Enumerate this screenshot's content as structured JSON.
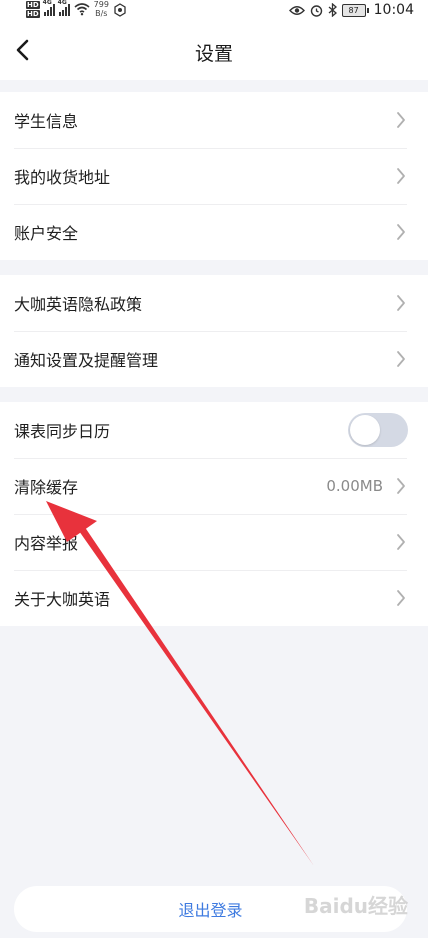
{
  "status_bar": {
    "sim1": "HD",
    "sim2": "HD",
    "net1": "4G",
    "net2": "4G",
    "speed_value": "799",
    "speed_unit": "B/s",
    "battery": "87",
    "time": "10:04"
  },
  "nav": {
    "title": "设置"
  },
  "groups": [
    {
      "items": [
        {
          "label": "学生信息"
        },
        {
          "label": "我的收货地址"
        },
        {
          "label": "账户安全"
        }
      ]
    },
    {
      "items": [
        {
          "label": "大咖英语隐私政策"
        },
        {
          "label": "通知设置及提醒管理"
        }
      ]
    },
    {
      "items": [
        {
          "label": "课表同步日历"
        },
        {
          "label": "清除缓存",
          "value": "0.00MB"
        },
        {
          "label": "内容举报"
        },
        {
          "label": "关于大咖英语"
        }
      ]
    }
  ],
  "logout": {
    "label": "退出登录"
  },
  "colors": {
    "accent": "#3F7BE0",
    "annotation_arrow": "#E8323C",
    "background": "#F3F4F8"
  },
  "watermark": "Baidu经验"
}
